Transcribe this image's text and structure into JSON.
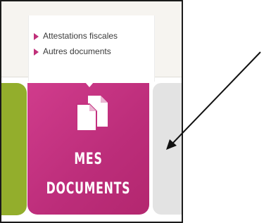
{
  "dropdown": {
    "items": [
      {
        "label": "Attestations fiscales",
        "icon": "triangle-bullet-icon"
      },
      {
        "label": "Autres documents",
        "icon": "triangle-bullet-icon"
      }
    ]
  },
  "tile": {
    "line1": "MES",
    "line2": "DOCUMENTS",
    "icon": "documents-icon"
  },
  "colors": {
    "tile_magenta": "#c4317f",
    "tile_green": "#93ae2c",
    "tile_gray": "#e3e3e3",
    "bullet": "#c0307a"
  }
}
